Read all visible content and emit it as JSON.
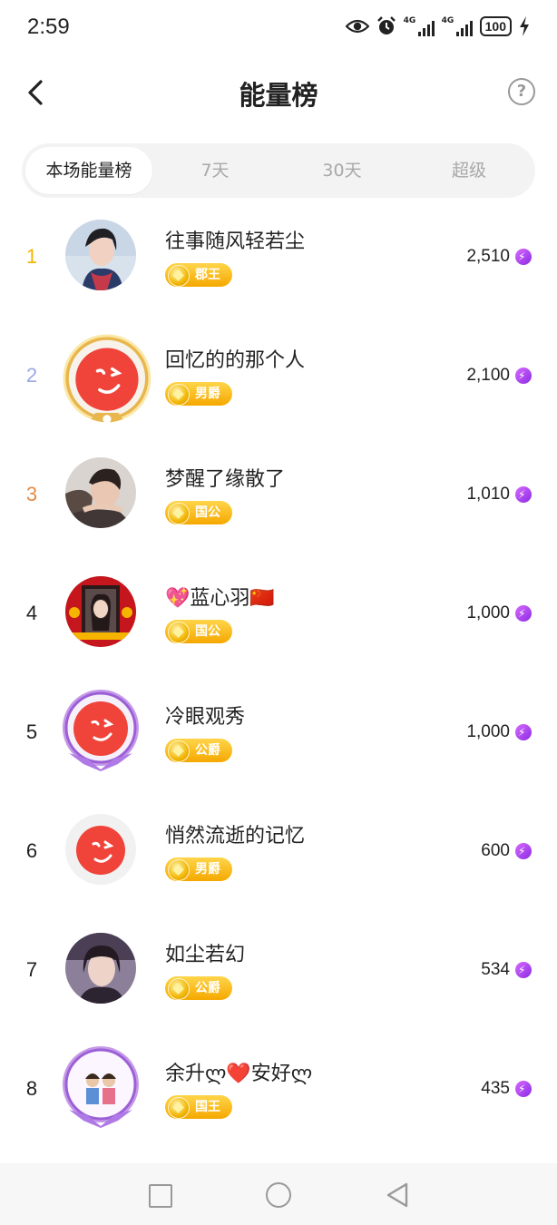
{
  "status": {
    "time": "2:59",
    "net1": "4G",
    "net2": "4G",
    "battery": "100",
    "icons": [
      "eye-icon",
      "alarm-icon",
      "signal-icon",
      "signal-icon",
      "battery-icon",
      "charging-icon"
    ]
  },
  "header": {
    "title": "能量榜",
    "help_label": "?"
  },
  "tabs": [
    {
      "label": "本场能量榜",
      "active": true
    },
    {
      "label": "7天",
      "active": false
    },
    {
      "label": "30天",
      "active": false
    },
    {
      "label": "超级",
      "active": false
    }
  ],
  "ranking": [
    {
      "rank": "1",
      "name": "往事随风轻若尘",
      "title": "郡王",
      "energy": "2,510",
      "rank_color": "#f5b400"
    },
    {
      "rank": "2",
      "name": "回忆的的那个人",
      "title": "男爵",
      "energy": "2,100",
      "rank_color": "#9aa8e6"
    },
    {
      "rank": "3",
      "name": "梦醒了缘散了",
      "title": "国公",
      "energy": "1,010",
      "rank_color": "#e58b45"
    },
    {
      "rank": "4",
      "name": "💖蓝心羽🇨🇳",
      "title": "国公",
      "energy": "1,000",
      "rank_color": "#222222"
    },
    {
      "rank": "5",
      "name": "冷眼观秀",
      "title": "公爵",
      "energy": "1,000",
      "rank_color": "#222222"
    },
    {
      "rank": "6",
      "name": "悄然流逝的记忆",
      "title": "男爵",
      "energy": "600",
      "rank_color": "#222222"
    },
    {
      "rank": "7",
      "name": "如尘若幻",
      "title": "公爵",
      "energy": "534",
      "rank_color": "#222222"
    },
    {
      "rank": "8",
      "name": "余升ლ❤️安好ლ",
      "title": "国王",
      "energy": "435",
      "rank_color": "#222222"
    }
  ],
  "colors": {
    "badge": "#f5a800",
    "energy_icon": "#a03cf0",
    "accent_red": "#f0443a"
  }
}
